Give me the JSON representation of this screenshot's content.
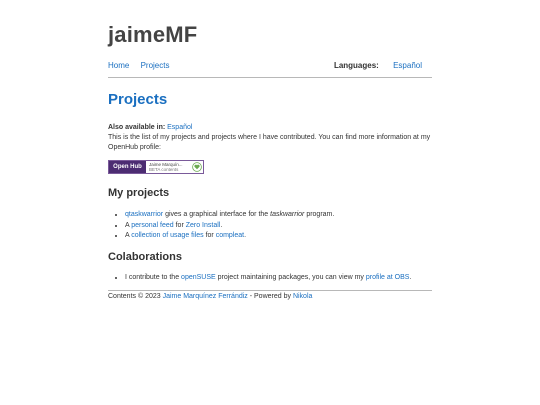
{
  "site": {
    "title": "jaimeMF"
  },
  "nav": {
    "items": [
      "Home",
      "Projects"
    ],
    "languages_label": "Languages:",
    "language_link": "Español"
  },
  "page": {
    "title": "Projects",
    "also_available_label": "Also available in:",
    "also_available_link": "Español",
    "intro": "This is the list of my projects and projects where I have contributed. You can find more information at my OpenHub profile:"
  },
  "badge": {
    "brand": "Open Hub",
    "name": "Jaime Marquín...",
    "subtitle": "BETA contents"
  },
  "my_projects": {
    "heading": "My projects",
    "item1": {
      "link": "qtaskwarrior",
      "text1": " gives a graphical interface for the ",
      "em": "taskwarrior",
      "text2": " program."
    },
    "item2": {
      "prefix": "A ",
      "link1": "personal feed",
      "mid": " for ",
      "link2": "Zero Install",
      "suffix": "."
    },
    "item3": {
      "prefix": "A ",
      "link1": "collection of usage files",
      "mid": " for ",
      "link2": "compleat",
      "suffix": "."
    }
  },
  "colaborations": {
    "heading": "Colaborations",
    "text1": "I contribute to the ",
    "link1": "openSUSE",
    "text2": " project maintaining packages, you can view my ",
    "link2": "profile at OBS",
    "text3": "."
  },
  "footer": {
    "prefix": "Contents © 2023 ",
    "author": "Jaime Marquínez Ferrándiz",
    "mid": " - Powered by ",
    "engine": "Nikola"
  }
}
